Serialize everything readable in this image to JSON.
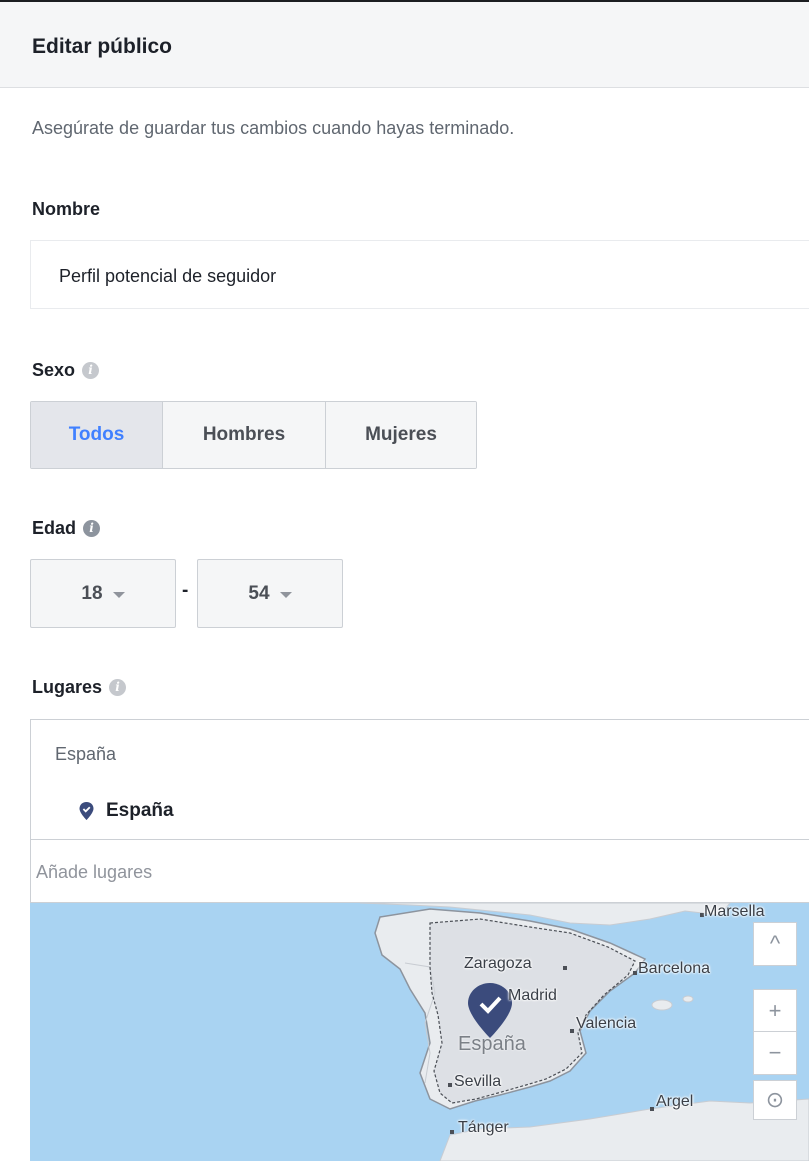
{
  "header": {
    "title": "Editar público"
  },
  "hint": "Asegúrate de guardar tus cambios cuando hayas terminado.",
  "name_section": {
    "label": "Nombre",
    "value": "Perfil potencial de seguidor"
  },
  "gender_section": {
    "label": "Sexo",
    "options": [
      "Todos",
      "Hombres",
      "Mujeres"
    ],
    "selected": "Todos"
  },
  "age_section": {
    "label": "Edad",
    "min": "18",
    "max": "54",
    "separator": "-"
  },
  "places_section": {
    "label": "Lugares",
    "group_header": "España",
    "selected_place": "España",
    "add_placeholder": "Añade lugares"
  },
  "map": {
    "country_label": "España",
    "cities": [
      "Marsella",
      "Zaragoza",
      "Barcelona",
      "Madrid",
      "Valencia",
      "Sevilla",
      "Argel",
      "Tánger"
    ],
    "controls": {
      "up": "^",
      "zoom_in": "+",
      "zoom_out": "−",
      "recenter": "⊙"
    }
  },
  "colors": {
    "accent": "#4080ff",
    "pin": "#3b4b7c",
    "water": "#a9d3f2",
    "land": "#e9ecef"
  }
}
